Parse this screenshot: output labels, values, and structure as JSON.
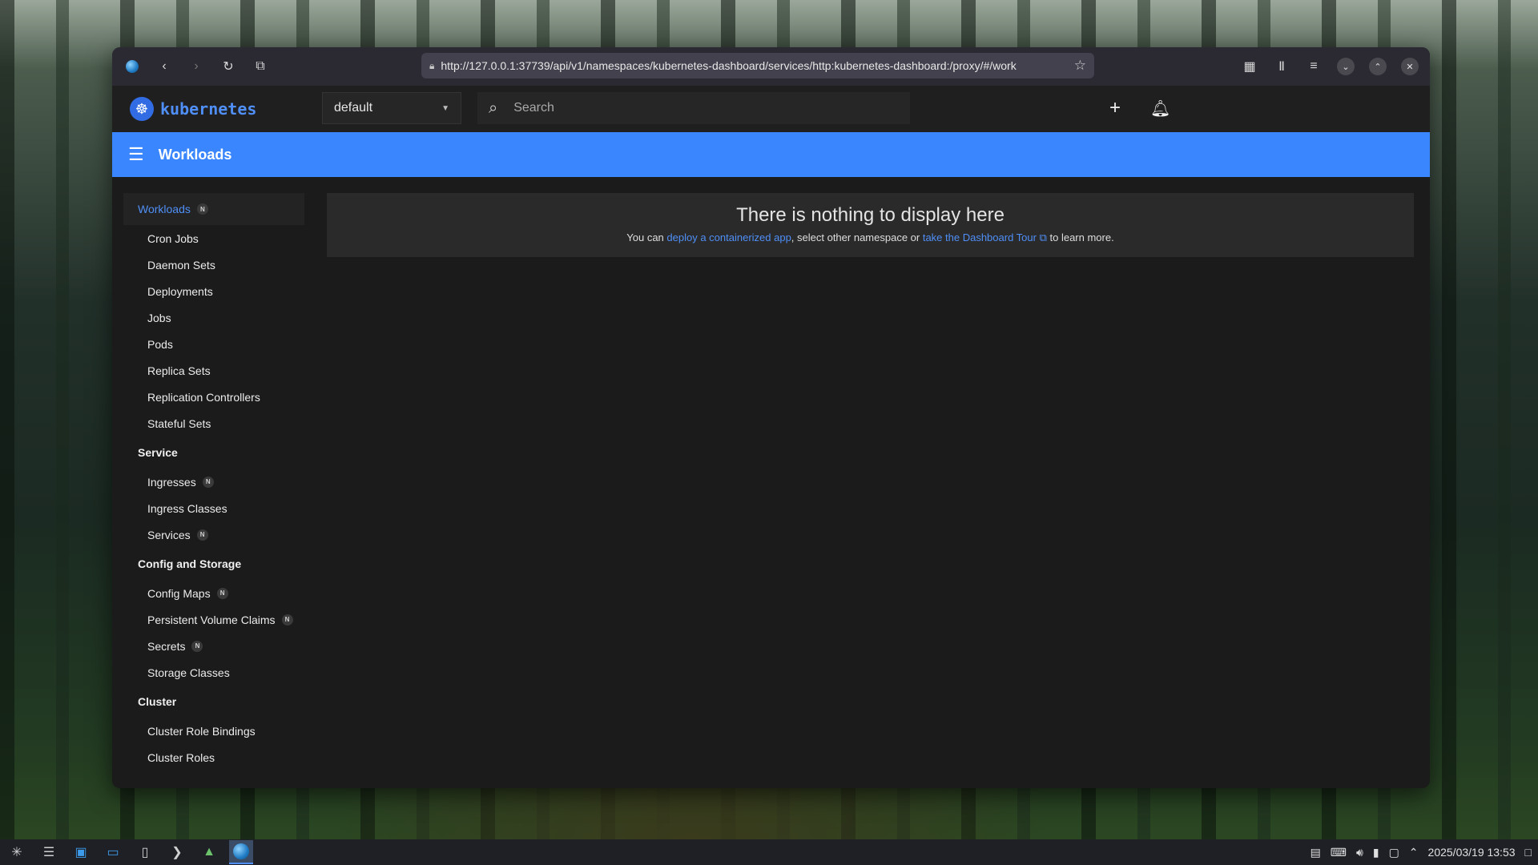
{
  "browser": {
    "url": "http://127.0.0.1:37739/api/v1/namespaces/kubernetes-dashboard/services/http:kubernetes-dashboard:/proxy/#/work"
  },
  "header": {
    "logo_text": "kubernetes",
    "namespace": "default",
    "search_placeholder": "Search"
  },
  "toolbar": {
    "title": "Workloads"
  },
  "sidebar": {
    "workloads": {
      "label": "Workloads",
      "badge": "N",
      "items": [
        "Cron Jobs",
        "Daemon Sets",
        "Deployments",
        "Jobs",
        "Pods",
        "Replica Sets",
        "Replication Controllers",
        "Stateful Sets"
      ]
    },
    "service": {
      "label": "Service",
      "items": [
        {
          "label": "Ingresses",
          "badge": "N"
        },
        {
          "label": "Ingress Classes"
        },
        {
          "label": "Services",
          "badge": "N"
        }
      ]
    },
    "config": {
      "label": "Config and Storage",
      "items": [
        {
          "label": "Config Maps",
          "badge": "N"
        },
        {
          "label": "Persistent Volume Claims",
          "badge": "N"
        },
        {
          "label": "Secrets",
          "badge": "N"
        },
        {
          "label": "Storage Classes"
        }
      ]
    },
    "cluster": {
      "label": "Cluster",
      "items": [
        "Cluster Role Bindings",
        "Cluster Roles"
      ]
    }
  },
  "empty_state": {
    "title": "There is nothing to display here",
    "prefix": "You can ",
    "link1": "deploy a containerized app",
    "middle": ", select other namespace or ",
    "link2": "take the Dashboard Tour",
    "suffix": " to learn more."
  },
  "taskbar": {
    "datetime": "2025/03/19  13:53"
  }
}
